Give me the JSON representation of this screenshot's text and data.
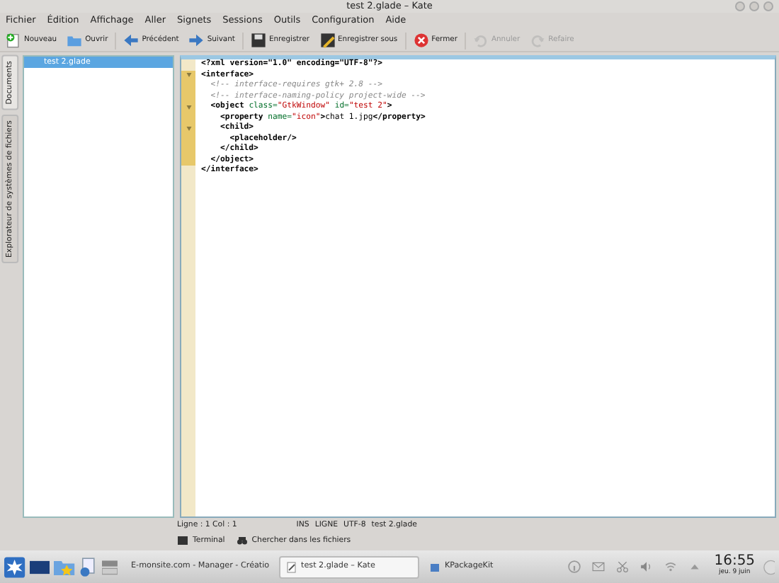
{
  "window": {
    "title": "test 2.glade – Kate"
  },
  "menu": [
    "Fichier",
    "Édition",
    "Affichage",
    "Aller",
    "Signets",
    "Sessions",
    "Outils",
    "Configuration",
    "Aide"
  ],
  "toolbar": [
    {
      "kind": "new",
      "label": "Nouveau",
      "disabled": false
    },
    {
      "kind": "open",
      "label": "Ouvrir",
      "disabled": false
    },
    {
      "kind": "back",
      "label": "Précédent",
      "disabled": false
    },
    {
      "kind": "forward",
      "label": "Suivant",
      "disabled": false
    },
    {
      "kind": "save",
      "label": "Enregistrer",
      "disabled": false
    },
    {
      "kind": "saveas",
      "label": "Enregistrer sous",
      "disabled": false
    },
    {
      "kind": "close",
      "label": "Fermer",
      "disabled": false
    },
    {
      "kind": "undo",
      "label": "Annuler",
      "disabled": true
    },
    {
      "kind": "redo",
      "label": "Refaire",
      "disabled": true
    }
  ],
  "side_tabs": [
    {
      "label": "Documents",
      "selected": true
    },
    {
      "label": "Explorateur de systèmes de fichiers",
      "selected": false
    }
  ],
  "documents": [
    {
      "name": "test 2.glade",
      "selected": true
    }
  ],
  "editor": {
    "lines": [
      {
        "fold": false,
        "modified": false,
        "segments": [
          {
            "kind": "tag",
            "text": "<?xml "
          },
          {
            "kind": "tag",
            "text": "version=\"1.0\" encoding=\"UTF-8\"?>"
          }
        ]
      },
      {
        "fold": true,
        "modified": true,
        "segments": [
          {
            "kind": "tag",
            "text": "<interface>"
          }
        ]
      },
      {
        "fold": false,
        "modified": true,
        "segments": [
          {
            "kind": "comment",
            "text": "  <!-- interface-requires gtk+ 2.8 -->"
          }
        ]
      },
      {
        "fold": false,
        "modified": true,
        "segments": [
          {
            "kind": "comment",
            "text": "  <!-- interface-naming-policy project-wide -->"
          }
        ]
      },
      {
        "fold": true,
        "modified": true,
        "segments": [
          {
            "kind": "tag",
            "text": "  <object "
          },
          {
            "kind": "attr",
            "text": "class="
          },
          {
            "kind": "string",
            "text": "\"GtkWindow\""
          },
          {
            "kind": "attr",
            "text": " id="
          },
          {
            "kind": "string",
            "text": "\"test 2\""
          },
          {
            "kind": "tag",
            "text": ">"
          }
        ]
      },
      {
        "fold": false,
        "modified": true,
        "segments": [
          {
            "kind": "tag",
            "text": "    <property "
          },
          {
            "kind": "attr",
            "text": "name="
          },
          {
            "kind": "string",
            "text": "\"icon\""
          },
          {
            "kind": "tag",
            "text": ">"
          },
          {
            "kind": "text",
            "text": "chat 1.jpg"
          },
          {
            "kind": "tag",
            "text": "</property>"
          }
        ]
      },
      {
        "fold": true,
        "modified": true,
        "segments": [
          {
            "kind": "tag",
            "text": "    <child>"
          }
        ]
      },
      {
        "fold": false,
        "modified": true,
        "segments": [
          {
            "kind": "tag",
            "text": "      <placeholder/>"
          }
        ]
      },
      {
        "fold": false,
        "modified": true,
        "segments": [
          {
            "kind": "tag",
            "text": "    </child>"
          }
        ]
      },
      {
        "fold": false,
        "modified": true,
        "segments": [
          {
            "kind": "tag",
            "text": "  </object>"
          }
        ]
      },
      {
        "fold": false,
        "modified": false,
        "segments": [
          {
            "kind": "tag",
            "text": "</interface>"
          }
        ]
      }
    ]
  },
  "status_bar": {
    "position": "Ligne : 1 Col : 1",
    "mode": "INS",
    "selection": "LIGNE",
    "encoding": "UTF-8",
    "file": "test 2.glade"
  },
  "bottom_tools": [
    {
      "kind": "terminal",
      "label": "Terminal"
    },
    {
      "kind": "find",
      "label": "Chercher dans les fichiers"
    }
  ],
  "taskbar": {
    "tasks": [
      {
        "kind": "web",
        "label": "E-monsite.com - Manager - Créatio",
        "selected": false
      },
      {
        "kind": "doc",
        "label": "test 2.glade – Kate",
        "selected": true
      },
      {
        "kind": "pkg",
        "label": "KPackageKit",
        "selected": false
      }
    ],
    "time": "16:55",
    "date": "jeu. 9 juin"
  }
}
